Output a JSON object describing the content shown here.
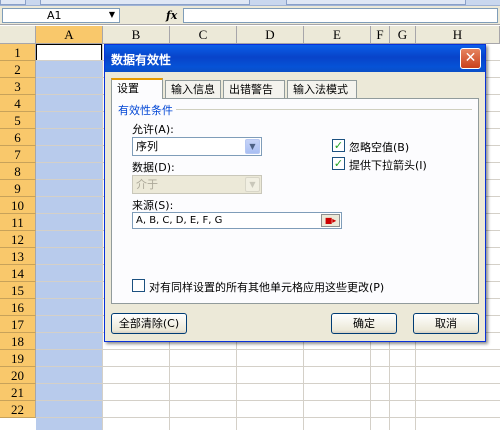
{
  "name_box": {
    "value": "A1"
  },
  "formula_bar": {
    "fx": "fx",
    "value": ""
  },
  "columns": [
    "A",
    "B",
    "C",
    "D",
    "E",
    "F",
    "G",
    "H"
  ],
  "selected_column": "A",
  "rows": [
    "1",
    "2",
    "3",
    "4",
    "5",
    "6",
    "7",
    "8",
    "9",
    "10",
    "11",
    "12",
    "13",
    "14",
    "15",
    "16",
    "17",
    "18",
    "19",
    "20",
    "21",
    "22"
  ],
  "dialog": {
    "title": "数据有效性",
    "close": "✕",
    "tabs": [
      "设置",
      "输入信息",
      "出错警告",
      "输入法模式"
    ],
    "active_tab": "设置",
    "group_title": "有效性条件",
    "allow_label": "允许(A):",
    "allow_value": "序列",
    "data_label": "数据(D):",
    "data_value": "介于",
    "source_label": "来源(S):",
    "source_value": "A, B, C, D, E, F, G",
    "ignore_blank_label": "忽略空值(B)",
    "ignore_blank_checked": true,
    "dropdown_label": "提供下拉箭头(I)",
    "dropdown_checked": true,
    "apply_all_label": "对有同样设置的所有其他单元格应用这些更改(P)",
    "apply_all_checked": false,
    "clear_all_label": "全部清除(C)",
    "ok_label": "确定",
    "cancel_label": "取消"
  },
  "colors": {
    "title_bar": "#0a4fc7",
    "header_selected": "#f9c86b",
    "column_selected": "#b8cbec",
    "dialog_bg": "#ece9d8"
  }
}
